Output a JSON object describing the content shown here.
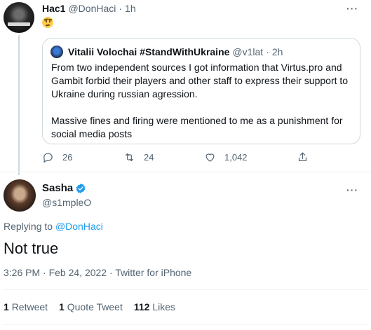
{
  "original_tweet": {
    "author_name": "Hac1",
    "author_handle": "@DonHaci",
    "time_ago": "1h",
    "emoji_icon": "thinking-face",
    "more_label": "···",
    "quoted": {
      "author_name": "Vitalii Volochai #StandWithUkraine",
      "author_handle": "@v1lat",
      "time_ago": "2h",
      "text": "From two independent sources I got information that Virtus.pro and Gambit forbid their players and other staff to express their support to Ukraine during russian agression.\n\nMassive fines and firing were mentioned to me as a punishment for social media posts"
    },
    "actions": {
      "replies": "26",
      "retweets": "24",
      "likes": "1,042"
    }
  },
  "reply_tweet": {
    "author_name": "Sasha",
    "author_handle": "@s1mpleO",
    "more_label": "···",
    "replying_prefix": "Replying to",
    "replying_to": "@DonHaci",
    "text": "Not true",
    "meta": "3:26 PM · Feb 24, 2022 · Twitter for iPhone",
    "stats": {
      "retweets_count": "1",
      "retweets_label": "Retweet",
      "quotes_count": "1",
      "quotes_label": "Quote Tweet",
      "likes_count": "112",
      "likes_label": "Likes"
    }
  },
  "colors": {
    "accent": "#1d9bf0",
    "secondary_text": "#536471",
    "border": "#cfd9de"
  }
}
